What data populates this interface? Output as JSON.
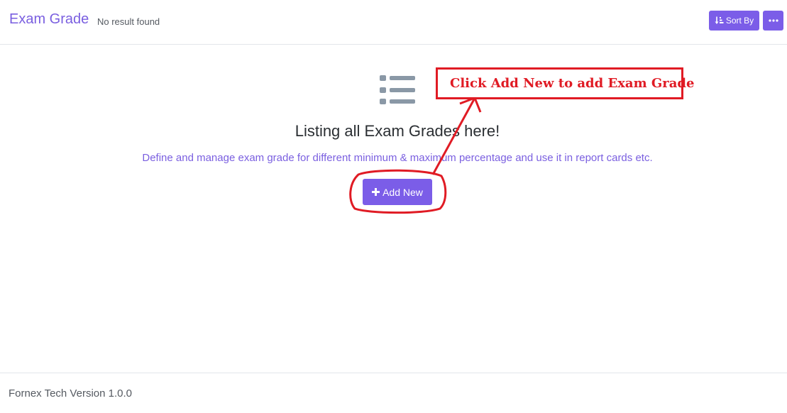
{
  "header": {
    "title": "Exam Grade",
    "subtitle": "No result found",
    "sort_label": "Sort By",
    "sort_icon": "sort-amount-down-icon",
    "more_icon": "ellipsis-icon"
  },
  "empty_state": {
    "icon": "list-icon",
    "title": "Listing all Exam Grades here!",
    "description": "Define and manage exam grade for different minimum & maximum percentage and use it in report cards etc.",
    "add_label": "Add New",
    "add_icon": "plus-icon"
  },
  "annotation": {
    "text": "Click Add New to add Exam Grade",
    "color": "#e01b24"
  },
  "footer": {
    "text": "Fornex Tech Version 1.0.0"
  },
  "colors": {
    "accent": "#7b5de8",
    "accent_text": "#7a5fe0",
    "icon_gray": "#8a98a6"
  }
}
